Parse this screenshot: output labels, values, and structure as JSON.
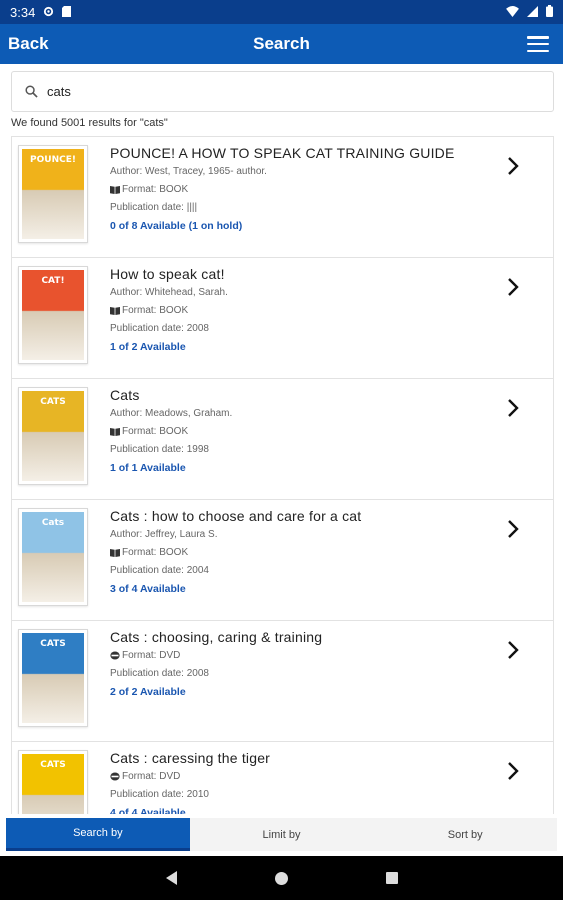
{
  "status": {
    "time": "3:34"
  },
  "header": {
    "back_label": "Back",
    "title": "Search"
  },
  "search": {
    "value": "cats",
    "results_text": "We found 5001 results for \"cats\""
  },
  "results": [
    {
      "title": "POUNCE! A HOW TO SPEAK CAT TRAINING GUIDE",
      "author": "Author: West, Tracey, 1965- author.",
      "format": "Format: BOOK",
      "format_icon": "book-icon",
      "pubdate": "Publication date: ||||",
      "availability": "0 of 8 Available (1 on hold)",
      "cover_label": "POUNCE!",
      "cover_color": "#f0b21a"
    },
    {
      "title": "How to speak cat!",
      "author": "Author: Whitehead, Sarah.",
      "format": "Format: BOOK",
      "format_icon": "book-icon",
      "pubdate": "Publication date: 2008",
      "availability": "1 of 2 Available",
      "cover_label": "CAT!",
      "cover_color": "#e8532e"
    },
    {
      "title": "Cats",
      "author": "Author: Meadows, Graham.",
      "format": "Format: BOOK",
      "format_icon": "book-icon",
      "pubdate": "Publication date: 1998",
      "availability": "1 of 1 Available",
      "cover_label": "CATS",
      "cover_color": "#e7b525"
    },
    {
      "title": "Cats : how to choose and care for a cat",
      "author": "Author: Jeffrey, Laura S.",
      "format": "Format: BOOK",
      "format_icon": "book-icon",
      "pubdate": "Publication date: 2004",
      "availability": "3 of 4 Available",
      "cover_label": "Cats",
      "cover_color": "#8fc3e6"
    },
    {
      "title": "Cats : choosing, caring & training",
      "author": "",
      "format": "Format: DVD",
      "format_icon": "disc-icon",
      "pubdate": "Publication date: 2008",
      "availability": "2 of 2 Available",
      "cover_label": "CATS",
      "cover_color": "#2f7ec4"
    },
    {
      "title": "Cats : caressing the tiger",
      "author": "",
      "format": "Format: DVD",
      "format_icon": "disc-icon",
      "pubdate": "Publication date: 2010",
      "availability": "4 of 4 Available",
      "cover_label": "CATS",
      "cover_color": "#f2c200"
    }
  ],
  "tabs": [
    {
      "label": "Search by",
      "active": true
    },
    {
      "label": "Limit by",
      "active": false
    },
    {
      "label": "Sort by",
      "active": false
    }
  ],
  "colors": {
    "primary": "#0d5bb5",
    "status_bar": "#0a3e8c",
    "link": "#1a56b0"
  }
}
